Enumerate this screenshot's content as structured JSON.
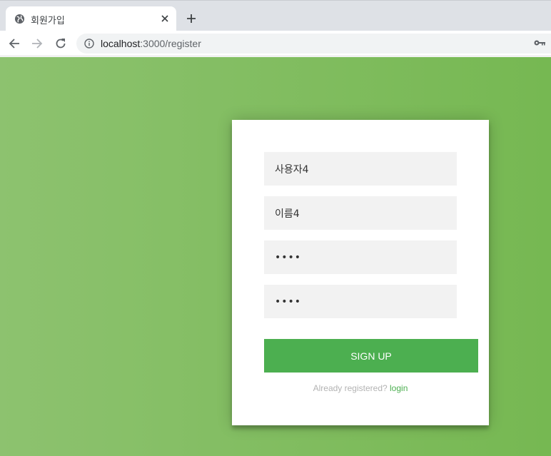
{
  "browser": {
    "tab_title": "회원가입",
    "url_host": "localhost",
    "url_path": ":3000/register"
  },
  "form": {
    "username_value": "사용자4",
    "name_value": "이름4",
    "password_value": "••••",
    "password_confirm_value": "••••",
    "submit_label": "SIGN UP",
    "message_text": "Already registered?",
    "login_link": "login"
  },
  "colors": {
    "gradient_left": "#8dc26f",
    "gradient_right": "#76b852",
    "button": "#4caf50",
    "field_bg": "#f2f2f2"
  }
}
